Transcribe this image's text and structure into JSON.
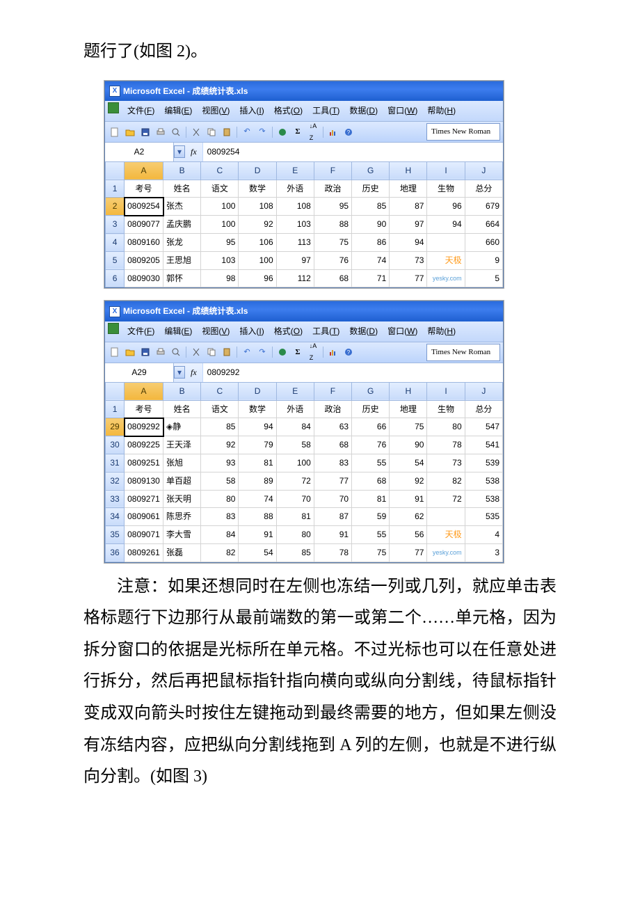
{
  "text": {
    "top_line": "题行了(如图 2)。",
    "bottom_para": "注意：如果还想同时在左侧也冻结一列或几列，就应单击表格标题行下边那行从最前端数的第一或第二个……单元格，因为拆分窗口的依据是光标所在单元格。不过光标也可以在任意处进行拆分，然后再把鼠标指针指向横向或纵向分割线，待鼠标指针变成双向箭头时按住左键拖动到最终需要的地方，但如果左侧没有冻结内容，应把纵向分割线拖到 A 列的左侧，也就是不进行纵向分割。(如图 3)"
  },
  "excel_common": {
    "title_prefix": "Microsoft Excel - ",
    "title_file": "成绩统计表.xls",
    "menus": [
      {
        "label": "文件",
        "accel": "F"
      },
      {
        "label": "编辑",
        "accel": "E"
      },
      {
        "label": "视图",
        "accel": "V"
      },
      {
        "label": "插入",
        "accel": "I"
      },
      {
        "label": "格式",
        "accel": "O"
      },
      {
        "label": "工具",
        "accel": "T"
      },
      {
        "label": "数据",
        "accel": "D"
      },
      {
        "label": "窗口",
        "accel": "W"
      },
      {
        "label": "帮助",
        "accel": "H"
      }
    ],
    "font_name": "Times New Roman",
    "columns": [
      "A",
      "B",
      "C",
      "D",
      "E",
      "F",
      "G",
      "H",
      "I",
      "J"
    ],
    "header_row": [
      "考号",
      "姓名",
      "语文",
      "数学",
      "外语",
      "政治",
      "历史",
      "地理",
      "生物",
      "总分"
    ],
    "watermark_brand": "天极",
    "watermark_url": "yesky.com"
  },
  "shot1": {
    "namebox": "A2",
    "fx": "0809254",
    "sel_col": "A",
    "rows": [
      {
        "n": 2,
        "d": [
          "0809254",
          "张杰",
          100,
          108,
          108,
          95,
          85,
          87,
          96,
          679
        ],
        "active": true
      },
      {
        "n": 3,
        "d": [
          "0809077",
          "孟庆鹏",
          100,
          92,
          103,
          88,
          90,
          97,
          94,
          664
        ]
      },
      {
        "n": 4,
        "d": [
          "0809160",
          "张龙",
          95,
          106,
          113,
          75,
          86,
          94,
          "",
          660
        ]
      },
      {
        "n": 5,
        "d": [
          "0809205",
          "王思旭",
          103,
          100,
          97,
          76,
          74,
          73,
          "天极",
          9
        ]
      },
      {
        "n": 6,
        "d": [
          "0809030",
          "郭怀",
          98,
          96,
          112,
          68,
          71,
          77,
          "yesky.com",
          5
        ]
      }
    ]
  },
  "shot2": {
    "namebox": "A29",
    "fx": "0809292",
    "sel_col": "A",
    "rows": [
      {
        "n": 29,
        "d": [
          "0809292",
          "◈静",
          85,
          94,
          84,
          63,
          66,
          75,
          80,
          547
        ],
        "active": true
      },
      {
        "n": 30,
        "d": [
          "0809225",
          "王天泽",
          92,
          79,
          58,
          68,
          76,
          90,
          78,
          541
        ]
      },
      {
        "n": 31,
        "d": [
          "0809251",
          "张旭",
          93,
          81,
          100,
          83,
          55,
          54,
          73,
          539
        ]
      },
      {
        "n": 32,
        "d": [
          "0809130",
          "单百超",
          58,
          89,
          72,
          77,
          68,
          92,
          82,
          538
        ]
      },
      {
        "n": 33,
        "d": [
          "0809271",
          "张天明",
          80,
          74,
          70,
          70,
          81,
          91,
          72,
          538
        ]
      },
      {
        "n": 34,
        "d": [
          "0809061",
          "陈思乔",
          83,
          88,
          81,
          87,
          59,
          62,
          "",
          535
        ]
      },
      {
        "n": 35,
        "d": [
          "0809071",
          "李大雪",
          84,
          91,
          80,
          91,
          55,
          56,
          "天极",
          4
        ]
      },
      {
        "n": 36,
        "d": [
          "0809261",
          "张磊",
          82,
          54,
          85,
          78,
          75,
          77,
          "yesky.com",
          3
        ]
      }
    ]
  }
}
